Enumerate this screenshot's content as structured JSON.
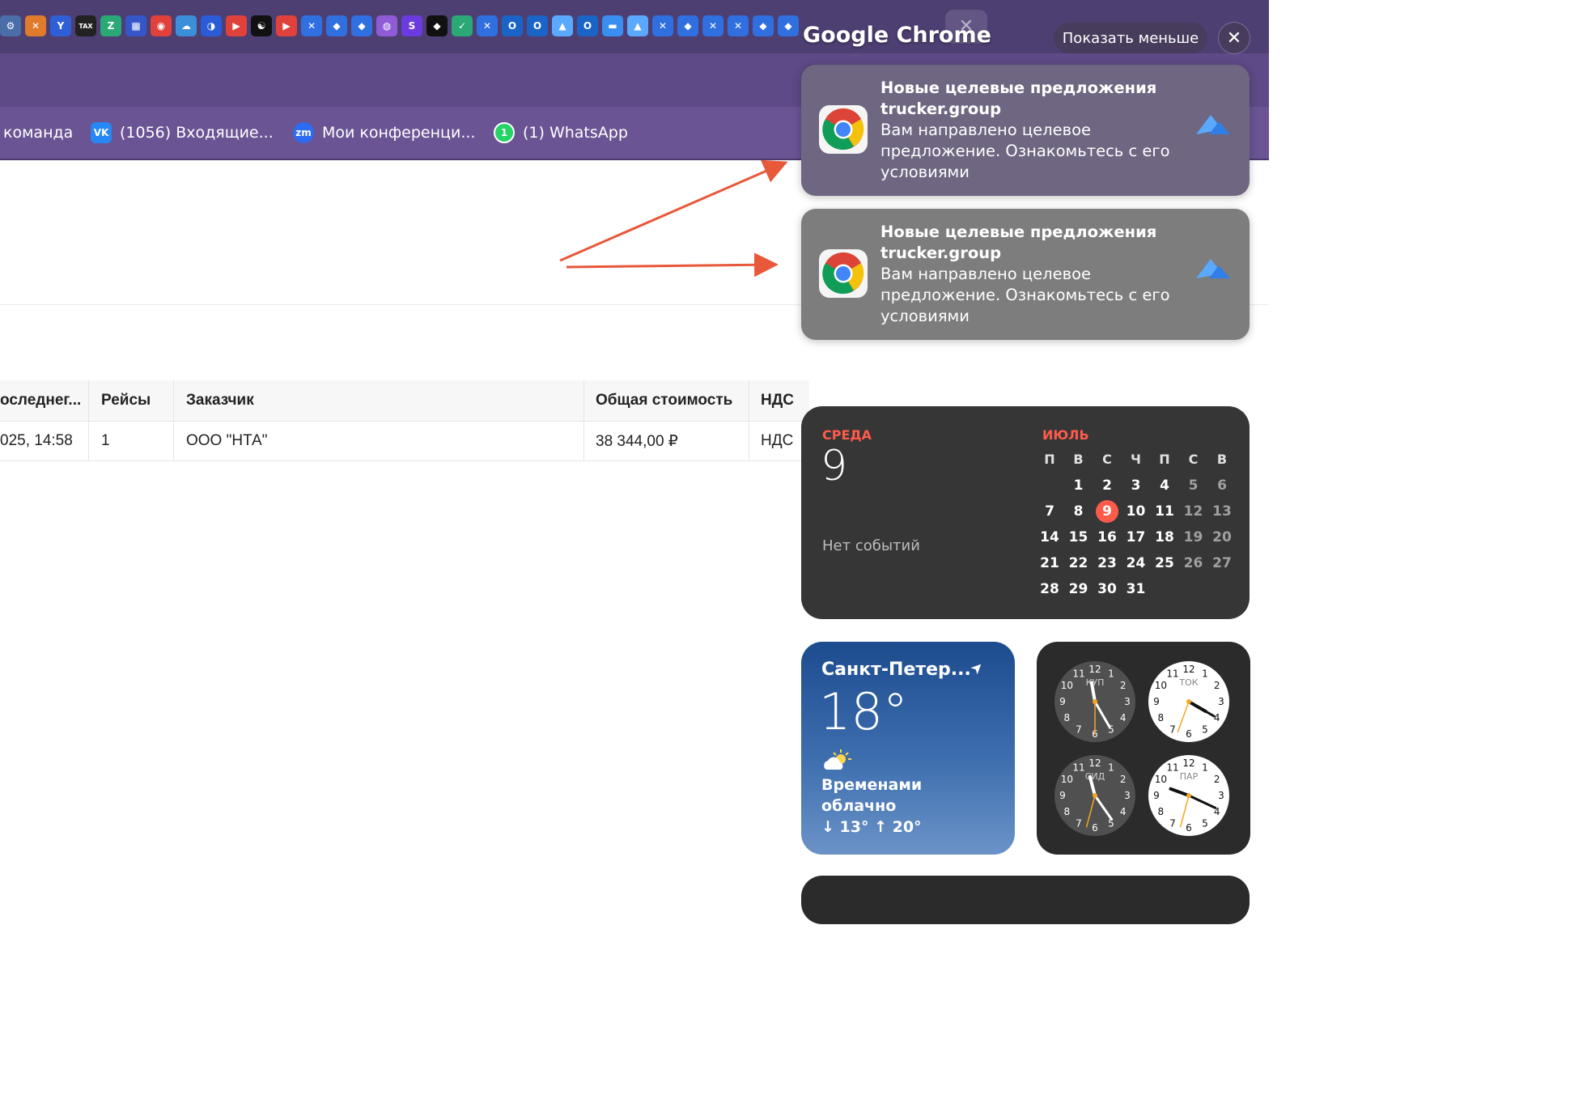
{
  "bookmarks": [
    {
      "label": "команда"
    },
    {
      "label": "(1056) Входящие...",
      "icon": "vk-icon"
    },
    {
      "label": "Мои конференци...",
      "icon": "zoom-icon"
    },
    {
      "label": "(1) WhatsApp",
      "icon": "whatsapp-icon"
    }
  ],
  "bookmark_icons": {
    "vk": "VK",
    "zoom": "zm",
    "whatsapp": "1"
  },
  "tab_strip": {
    "tab_icon_glyphs": [
      "⚙",
      "✕",
      "Y",
      "TAX",
      "Z",
      "▦",
      "◉",
      "☁",
      "◑",
      "▶",
      "☯",
      "▶",
      "✕",
      "◆",
      "◆",
      "◍",
      "S",
      "◆",
      "✓",
      "✕",
      "O",
      "O",
      "▲",
      "O",
      "▬",
      "▲",
      "✕",
      "◆",
      "✕",
      "✕",
      "◆",
      "◆"
    ]
  },
  "table": {
    "headers": [
      "оследнег...",
      "Рейсы",
      "Заказчик",
      "Общая стоимость",
      "НДС"
    ],
    "rows": [
      [
        "025, 14:58",
        "1",
        "ООО \"НТА\"",
        "38 344,00 ₽",
        "НДС"
      ]
    ]
  },
  "notification_center": {
    "title": "Google Chrome",
    "show_less": "Показать меньше",
    "close_glyph": "✕",
    "notifications": [
      {
        "title_line1": "Новые целевые предложения",
        "title_line2": "trucker.group",
        "body_line1": "Вам направлено целевое",
        "body_line2": "предложение. Ознакомьтесь с его",
        "body_line3": "условиями"
      },
      {
        "title_line1": "Новые целевые предложения",
        "title_line2": "trucker.group",
        "body_line1": "Вам направлено целевое",
        "body_line2": "предложение. Ознакомьтесь с его",
        "body_line3": "условиями"
      }
    ]
  },
  "calendar": {
    "weekday": "СРЕДА",
    "date": "9",
    "no_events": "Нет событий",
    "month": "ИЮЛЬ",
    "day_headers": [
      "П",
      "В",
      "С",
      "Ч",
      "П",
      "С",
      "В"
    ],
    "weeks": [
      [
        "",
        "1",
        "2",
        "3",
        "4",
        "5",
        "6"
      ],
      [
        "7",
        "8",
        "9",
        "10",
        "11",
        "12",
        "13"
      ],
      [
        "14",
        "15",
        "16",
        "17",
        "18",
        "19",
        "20"
      ],
      [
        "21",
        "22",
        "23",
        "24",
        "25",
        "26",
        "27"
      ],
      [
        "28",
        "29",
        "30",
        "31",
        "",
        "",
        ""
      ]
    ],
    "today": "9"
  },
  "weather": {
    "city": "Санкт-Петер...",
    "location_glyph": "➤",
    "temperature": "18°",
    "condition_line1": "Временами",
    "condition_line2": "облачно",
    "range": "↓ 13° ↑ 20°"
  },
  "clocks": [
    {
      "label": "КУП",
      "theme": "dark"
    },
    {
      "label": "ТОК",
      "theme": "light"
    },
    {
      "label": "СИД",
      "theme": "dark"
    },
    {
      "label": "ПАР",
      "theme": "light"
    }
  ],
  "colors": {
    "accent_red": "#ff5b4b",
    "arrow": "#e8583a",
    "tabstrip": "#4e3f73",
    "bookmarks_bar": "#6a5494"
  }
}
